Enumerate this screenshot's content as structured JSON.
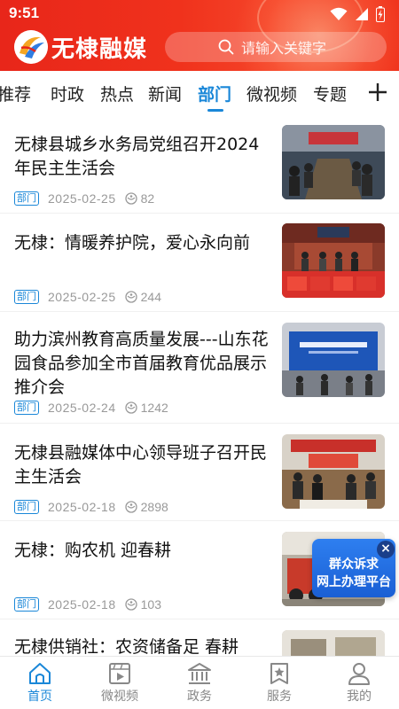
{
  "status": {
    "time": "9:51"
  },
  "header": {
    "app_name": "无棣融媒",
    "search_placeholder": "请输入关键字"
  },
  "tabs": [
    {
      "label": "推荐",
      "active": false
    },
    {
      "label": "时政",
      "active": false
    },
    {
      "label": "热点",
      "active": false
    },
    {
      "label": "新闻",
      "active": false
    },
    {
      "label": "部门",
      "active": true
    },
    {
      "label": "微视频",
      "active": false
    },
    {
      "label": "专题",
      "active": false
    }
  ],
  "articles": [
    {
      "title": "无棣县城乡水务局党组召开2024年民主生活会",
      "badge": "部门",
      "date": "2025-02-25",
      "views": "82"
    },
    {
      "title": "无棣：情暖养护院，爱心永向前",
      "badge": "部门",
      "date": "2025-02-25",
      "views": "244"
    },
    {
      "title": "助力滨州教育高质量发展---山东花园食品参加全市首届教育优品展示推介会",
      "badge": "部门",
      "date": "2025-02-24",
      "views": "1242"
    },
    {
      "title": "无棣县融媒体中心领导班子召开民主生活会",
      "badge": "部门",
      "date": "2025-02-18",
      "views": "2898"
    },
    {
      "title": "无棣：购农机 迎春耕",
      "badge": "部门",
      "date": "2025-02-18",
      "views": "103"
    },
    {
      "title": "无棣供销社：农资储备足 春耕"
    }
  ],
  "float_ad": {
    "line1": "群众诉求",
    "line2": "网上办理平台"
  },
  "bottom_nav": [
    {
      "label": "首页",
      "active": true
    },
    {
      "label": "微视频",
      "active": false
    },
    {
      "label": "政务",
      "active": false
    },
    {
      "label": "服务",
      "active": false
    },
    {
      "label": "我的",
      "active": false
    }
  ],
  "colors": {
    "brand_red": "#f0321c",
    "accent_blue": "#1a87d8",
    "meta_gray": "#999999"
  }
}
